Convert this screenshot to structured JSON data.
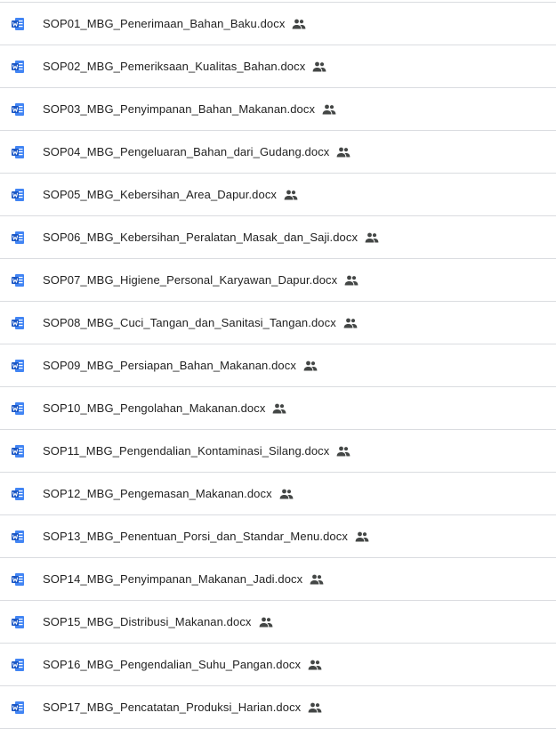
{
  "colors": {
    "word_blue": "#4285f4",
    "word_dark": "#1a56c4",
    "text": "#1f1f1f",
    "divider": "#dadce0",
    "shared_icon": "#444746"
  },
  "file_icon": "word-doc-icon",
  "shared_indicator_icon": "people-icon",
  "files": [
    {
      "name": "SOP01_MBG_Penerimaan_Bahan_Baku.docx",
      "shared": true
    },
    {
      "name": "SOP02_MBG_Pemeriksaan_Kualitas_Bahan.docx",
      "shared": true
    },
    {
      "name": "SOP03_MBG_Penyimpanan_Bahan_Makanan.docx",
      "shared": true
    },
    {
      "name": "SOP04_MBG_Pengeluaran_Bahan_dari_Gudang.docx",
      "shared": true
    },
    {
      "name": "SOP05_MBG_Kebersihan_Area_Dapur.docx",
      "shared": true
    },
    {
      "name": "SOP06_MBG_Kebersihan_Peralatan_Masak_dan_Saji.docx",
      "shared": true
    },
    {
      "name": "SOP07_MBG_Higiene_Personal_Karyawan_Dapur.docx",
      "shared": true
    },
    {
      "name": "SOP08_MBG_Cuci_Tangan_dan_Sanitasi_Tangan.docx",
      "shared": true
    },
    {
      "name": "SOP09_MBG_Persiapan_Bahan_Makanan.docx",
      "shared": true
    },
    {
      "name": "SOP10_MBG_Pengolahan_Makanan.docx",
      "shared": true
    },
    {
      "name": "SOP11_MBG_Pengendalian_Kontaminasi_Silang.docx",
      "shared": true
    },
    {
      "name": "SOP12_MBG_Pengemasan_Makanan.docx",
      "shared": true
    },
    {
      "name": "SOP13_MBG_Penentuan_Porsi_dan_Standar_Menu.docx",
      "shared": true
    },
    {
      "name": "SOP14_MBG_Penyimpanan_Makanan_Jadi.docx",
      "shared": true
    },
    {
      "name": "SOP15_MBG_Distribusi_Makanan.docx",
      "shared": true
    },
    {
      "name": "SOP16_MBG_Pengendalian_Suhu_Pangan.docx",
      "shared": true
    },
    {
      "name": "SOP17_MBG_Pencatatan_Produksi_Harian.docx",
      "shared": true
    }
  ]
}
